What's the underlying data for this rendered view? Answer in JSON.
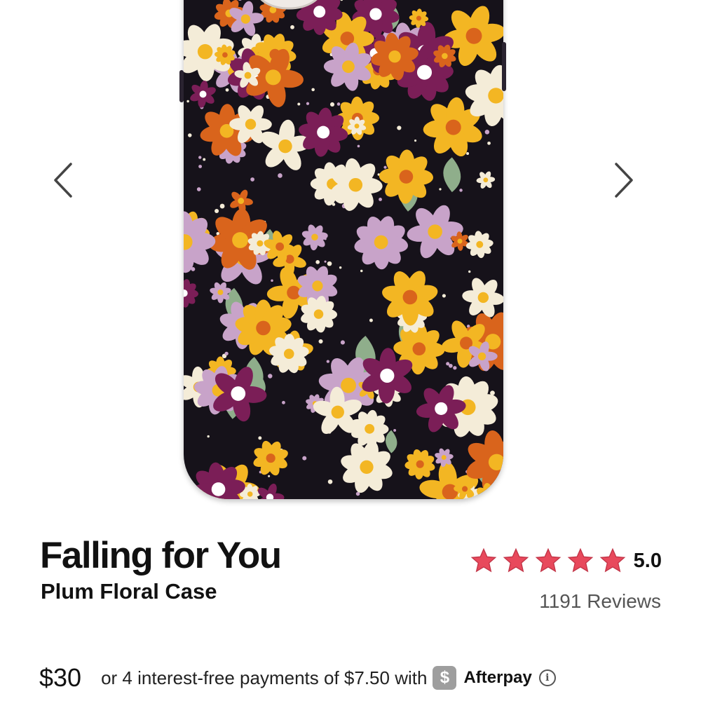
{
  "product": {
    "title": "Falling for You",
    "subtitle": "Plum Floral Case",
    "image_icon": "phone-case-image",
    "rating": {
      "value": "5.0",
      "stars": 5,
      "reviews": "1191 Reviews",
      "star_color": "#e8495c"
    },
    "price": "$30",
    "installment_text": "or 4 interest-free payments of $7.50 with",
    "provider_logo": "$",
    "provider_name": "Afterpay"
  },
  "carousel": {
    "prev_icon": "chevron-left-icon",
    "next_icon": "chevron-right-icon"
  },
  "colors": {
    "case_background": "#16121a",
    "plum": "#7b1e57",
    "mustard": "#f3b623",
    "orange": "#d9641c",
    "lilac": "#c8a3c9",
    "cream": "#f4ecd8",
    "sage": "#8fae8b"
  }
}
